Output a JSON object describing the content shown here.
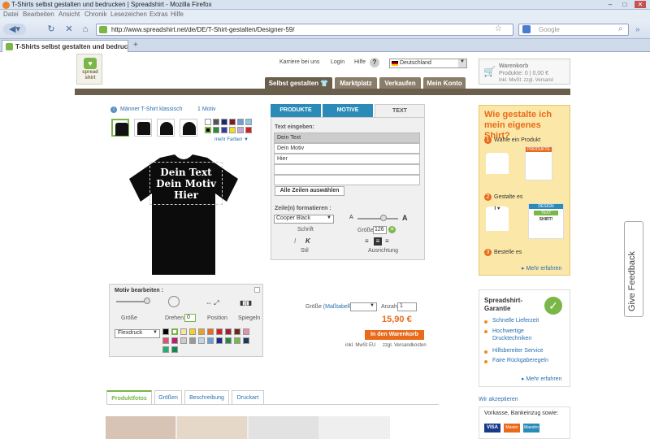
{
  "window": {
    "title": "T-Shirts selbst gestalten und bedrucken | Spreadshirt - Mozilla Firefox"
  },
  "menu": [
    "Datei",
    "Bearbeiten",
    "Ansicht",
    "Chronik",
    "Lesezeichen",
    "Extras",
    "Hilfe"
  ],
  "nav": {
    "url": "http://www.spreadshirt.net/de/DE/T-Shirt-gestalten/Designer-59/",
    "search_placeholder": "Google"
  },
  "tab": {
    "label": "T-Shirts selbst gestalten und bedruck...",
    "new_tab": "+"
  },
  "logo": {
    "text": "spread shirt"
  },
  "header": {
    "karriere": "Karriere bei uns",
    "login": "Login",
    "hilfe": "Hilfe",
    "help_btn": "?",
    "language": "Deutschland",
    "cart_title": "Warenkorb",
    "cart_products": "Produkte: 0 | 0,00 €",
    "cart_note": "inkl. MwSt. zzgl. Versand"
  },
  "navtabs": [
    "Selbst gestalten",
    "Marktplatz",
    "Verkaufen",
    "Mein Konto"
  ],
  "product": {
    "name": "Männer T-Shirt klassisch",
    "motif_count": "1 Motiv",
    "more_colors": "mehr Farben"
  },
  "design_text": [
    "Dein Text",
    "Dein Motiv",
    "Hier"
  ],
  "motiv": {
    "title": "Motiv bearbeiten :",
    "groesse": "Größe",
    "drehen": "Drehen:",
    "drehen_val": "0",
    "position": "Position",
    "spiegeln": "Spiegeln",
    "method": "Flexdruck"
  },
  "editor": {
    "tabs": [
      "PRODUKTE",
      "MOTIVE",
      "TEXT"
    ],
    "eingeben": "Text eingeben:",
    "lines": [
      "Dein Text",
      "Dein Motiv",
      "Hier",
      "",
      ""
    ],
    "select_all": "Alle Zeilen auswählen",
    "format_label": "Zeile(n) formatieren :",
    "font": "Cooper Black",
    "schrift": "Schrift",
    "size_label": "Größe:",
    "size_val": "126",
    "stil": "Stil",
    "ausrichtung": "Ausrichtung",
    "a_small": "A",
    "a_big": "A"
  },
  "order": {
    "groesse": "Größe",
    "masstabelle": "(Maßtabelle)",
    "anzahl": "Anzahl:",
    "anzahl_val": "1",
    "price": "15,90 €",
    "add": "In den Warenkorb",
    "mwst": "inkl. MwSt EU",
    "versand": "zzgl. Versandkosten"
  },
  "promo": {
    "title": "Wie gestalte ich mein eigenes Shirt?",
    "steps": [
      "Wähle ein Produkt",
      "Gestalte es",
      "Bestelle es"
    ],
    "card_produkte": "PRODUKTE",
    "card_design": "DESIGN",
    "card_text": "TEXT",
    "shirt_text": "SHIRT!",
    "more": "Mehr erfahren"
  },
  "garantie": {
    "title": "Spreadshirt-Garantie",
    "items": [
      "Schnelle Lieferzeit",
      "Hochwertige Drucktechniken",
      "Hilfsbereiter Service",
      "Faire Rückgaberegeln"
    ],
    "more": "Mehr erfahren"
  },
  "payment": {
    "title": "Wir akzeptieren",
    "sub": "Vorkasse, Bankeinzug sowie:",
    "cards": [
      "VISA",
      "Master",
      "Maestro"
    ]
  },
  "bottom_tabs": [
    "Produktfotos",
    "Größen",
    "Beschreibung",
    "Druckart"
  ],
  "feedback": "Give Feedback",
  "colors": {
    "accent": "#5a8fc4",
    "brand_green": "#7ab648",
    "price": "#e86a1a",
    "navtab": "#8a7e6a",
    "navtab_active": "#6a5e4c"
  }
}
